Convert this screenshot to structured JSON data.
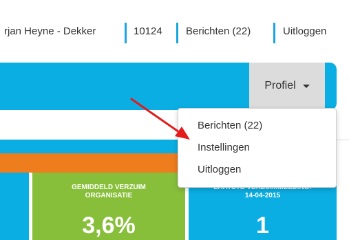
{
  "topnav": {
    "user_name": "rjan Heyne - Dekker",
    "user_id": "10124",
    "messages": "Berichten (22)",
    "logout": "Uitloggen"
  },
  "navbar": {
    "profile_label": "Profiel"
  },
  "profile_menu": {
    "items": [
      "Berichten (22)",
      "Instellingen",
      "Uitloggen"
    ]
  },
  "tiles": {
    "avg_absence": {
      "title": "GEMIDDELD VERZUIM ORGANISATIE",
      "value": "3,6%"
    },
    "last_report": {
      "title": "LAATSTE VERZUIMMELDING:",
      "date": "14-04-2015",
      "value": "1"
    }
  },
  "colors": {
    "nav_blue": "#0aaee3",
    "orange": "#ee7d1e",
    "green": "#88bf3a",
    "arrow_red": "#e31b1b"
  }
}
